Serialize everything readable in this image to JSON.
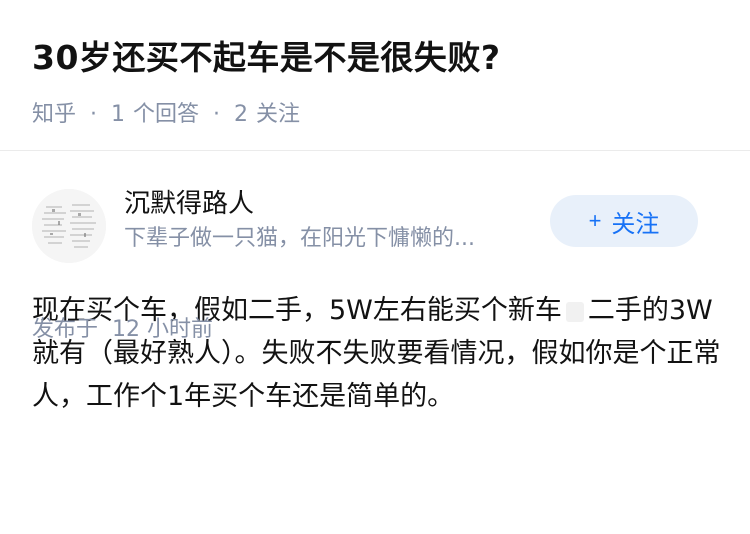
{
  "question": {
    "title": "30岁还买不起车是不是很失败?",
    "source": "知乎",
    "answer_count": "1",
    "answer_label": "个回答",
    "follow_count": "2",
    "follow_label": "关注",
    "separator": "·"
  },
  "answer": {
    "author": {
      "name": "沉默得路人",
      "bio": "下辈子做一只猫，在阳光下慵懒的..."
    },
    "follow_button": {
      "icon": "plus-icon",
      "icon_glyph": "+",
      "label": "关注"
    },
    "content_part1": "现在买个车，假如二手，5W左右能买个新车",
    "content_part2": "二手的3W就有（最好熟人）。失败不失败要看情况，假如你是个正常人，工作个1年买个车还是简单的。",
    "published_label": "发布于",
    "published_time": "12 小时前"
  },
  "colors": {
    "title": "#121212",
    "meta": "#8590a6",
    "accent": "#1772f6",
    "follow_bg": "#e8f0fa",
    "divider": "#ebebeb"
  }
}
